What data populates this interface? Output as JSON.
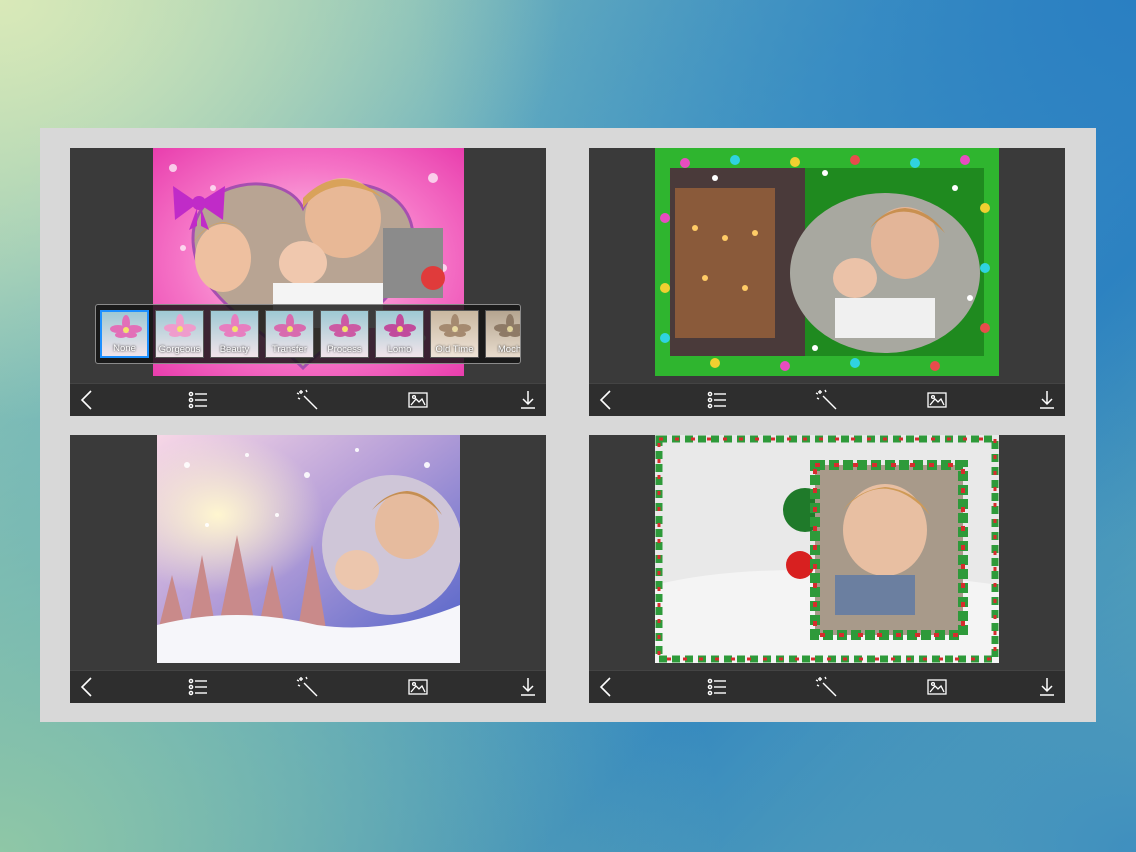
{
  "filters": [
    {
      "label": "None",
      "selected": true
    },
    {
      "label": "Gorgeous"
    },
    {
      "label": "Beauty"
    },
    {
      "label": "Transfer"
    },
    {
      "label": "Process"
    },
    {
      "label": "Lomo"
    },
    {
      "label": "Old Time"
    },
    {
      "label": "Moch"
    }
  ],
  "toolbar_icons": [
    "back-icon",
    "list-icon",
    "magic-wand-icon",
    "gallery-icon",
    "download-icon"
  ],
  "panels": [
    {
      "theme": "pink-heart-bow-frame"
    },
    {
      "theme": "christmas-garland-street-frame"
    },
    {
      "theme": "winter-forest-snow-frame"
    },
    {
      "theme": "christmas-tinsel-frame"
    }
  ],
  "colors": {
    "board": "#d8d8d8",
    "panel": "#3a3a3a",
    "toolbar": "#2e2e2e",
    "selected_filter": "#1e90ff"
  }
}
